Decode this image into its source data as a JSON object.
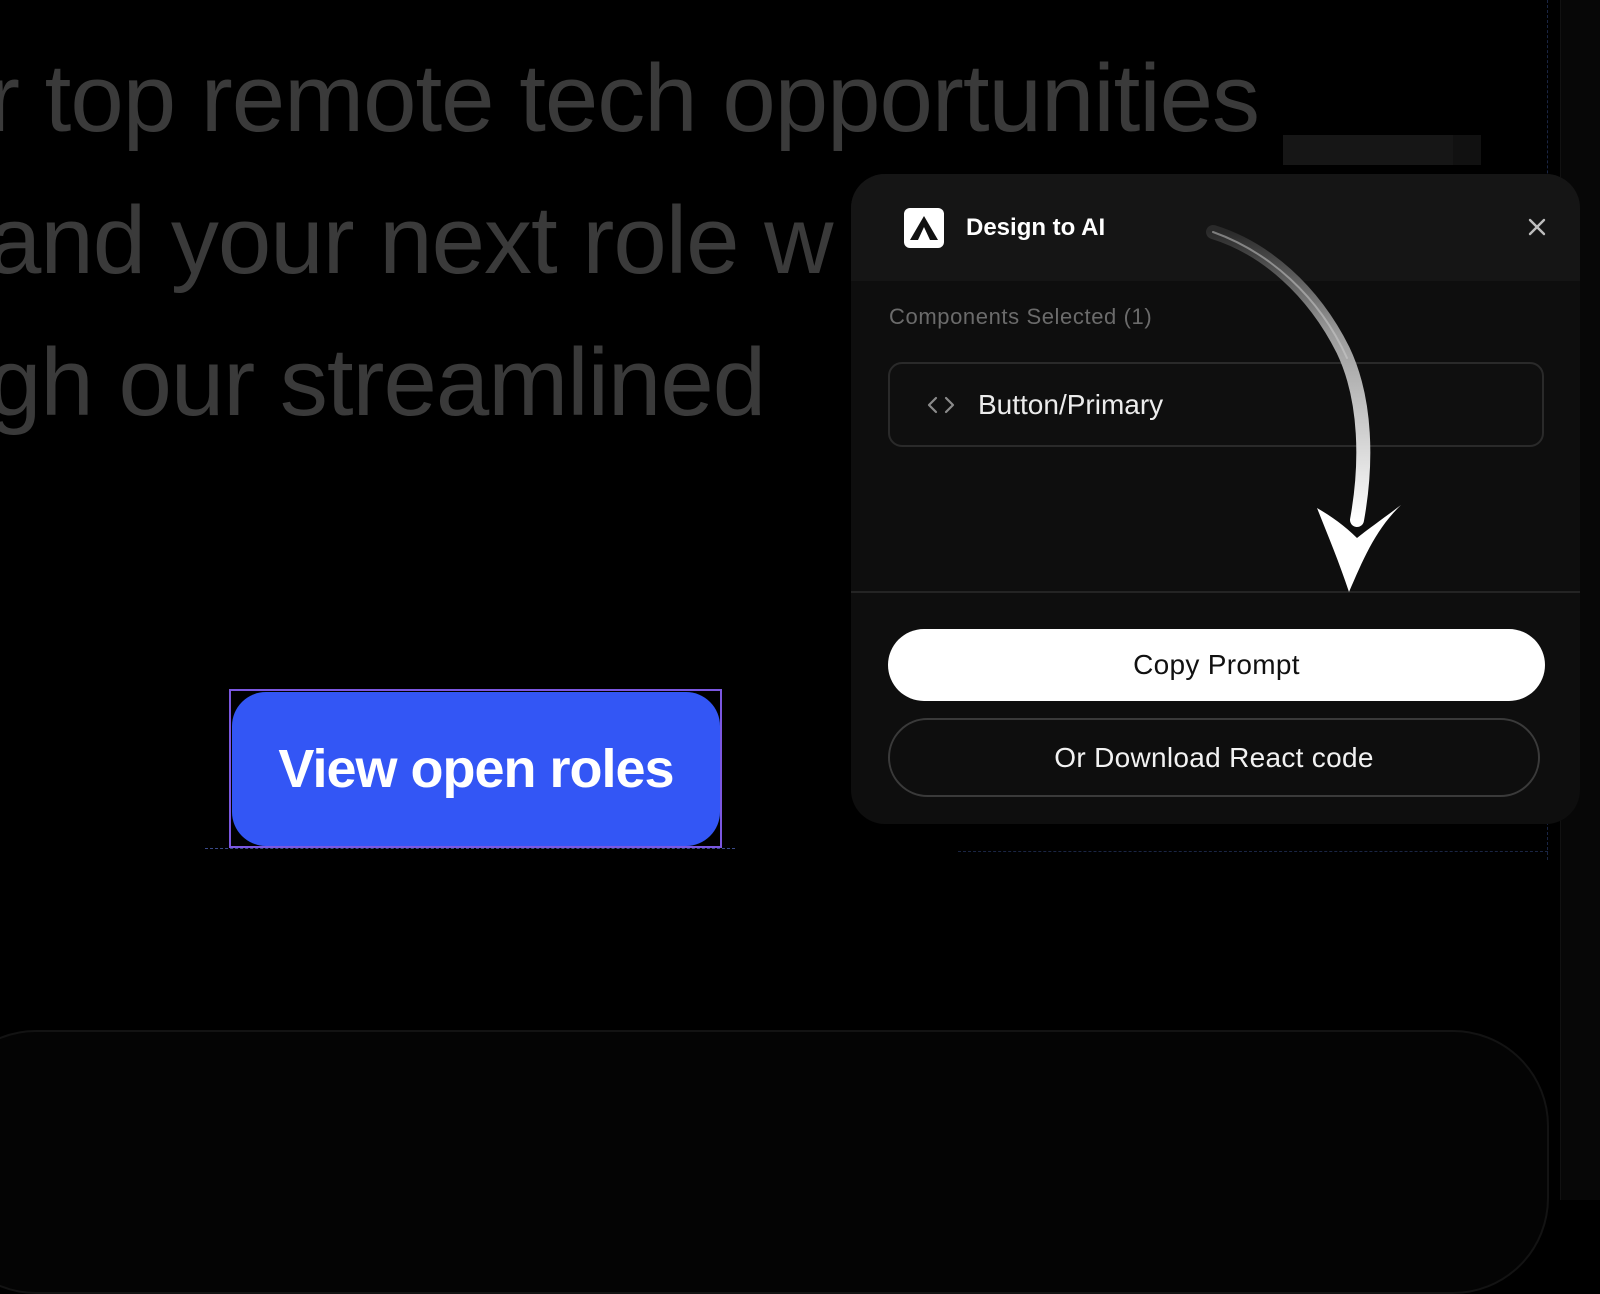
{
  "canvas": {
    "hero_lines": [
      "r top remote tech opportunities",
      "and your next role w",
      "gh our streamlined"
    ],
    "primary_button_label": "View open roles",
    "primary_button_color": "#3356f5",
    "selection_color": "#7b57e0"
  },
  "plugin": {
    "logo_icon": "triangle-logo-icon",
    "title": "Design to AI",
    "close_icon": "close-icon",
    "section_label": "Components Selected (1)",
    "components": [
      {
        "icon": "code-icon",
        "name": "Button/Primary"
      }
    ],
    "copy_prompt_label": "Copy Prompt",
    "download_label": "Or Download React code"
  }
}
